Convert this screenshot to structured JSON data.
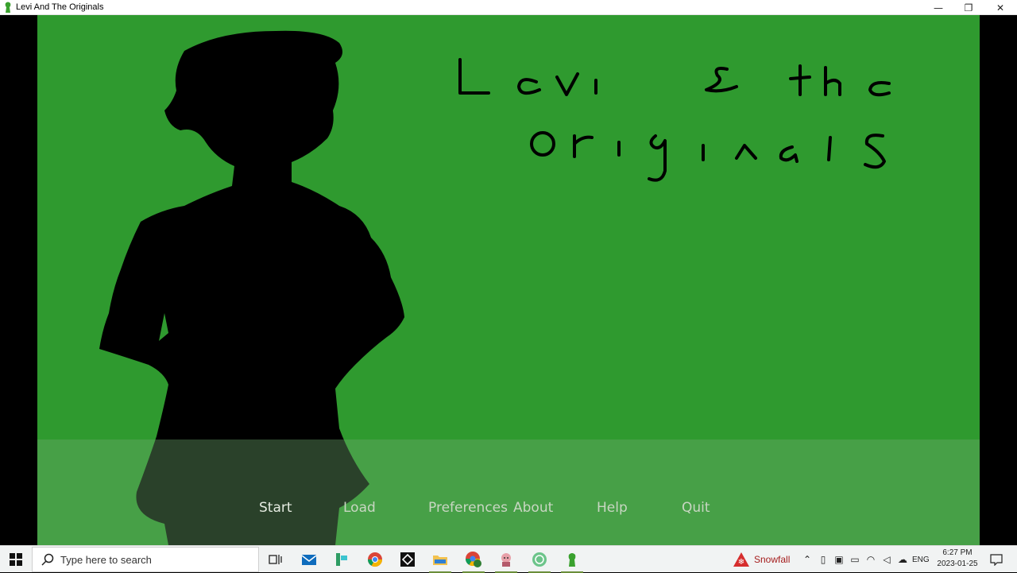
{
  "window": {
    "title": "Levi And The Originals",
    "controls": {
      "minimize": "—",
      "maximize": "❐",
      "close": "✕"
    }
  },
  "game": {
    "menu": [
      {
        "label": "Start",
        "active": true
      },
      {
        "label": "Load",
        "active": false
      },
      {
        "label": "Preferences",
        "active": false
      },
      {
        "label": "About",
        "active": false
      },
      {
        "label": "Help",
        "active": false
      },
      {
        "label": "Quit",
        "active": false
      }
    ],
    "colors": {
      "background": "#2f9a2f",
      "menu_text": "#c8d6c2",
      "silhouette": "#000000"
    }
  },
  "taskbar": {
    "search_placeholder": "Type here to search",
    "pinned_icons": [
      "task-view-icon",
      "mail-icon",
      "sticky-app-icon",
      "chrome-icon",
      "unity-icon",
      "file-explorer-icon",
      "chrome-profile-icon",
      "character-app-icon",
      "tea-app-icon",
      "game-app-icon"
    ],
    "weather": {
      "label": "Snowfall"
    },
    "language": "ENG",
    "time": "6:27 PM",
    "date": "2023-01-25"
  }
}
